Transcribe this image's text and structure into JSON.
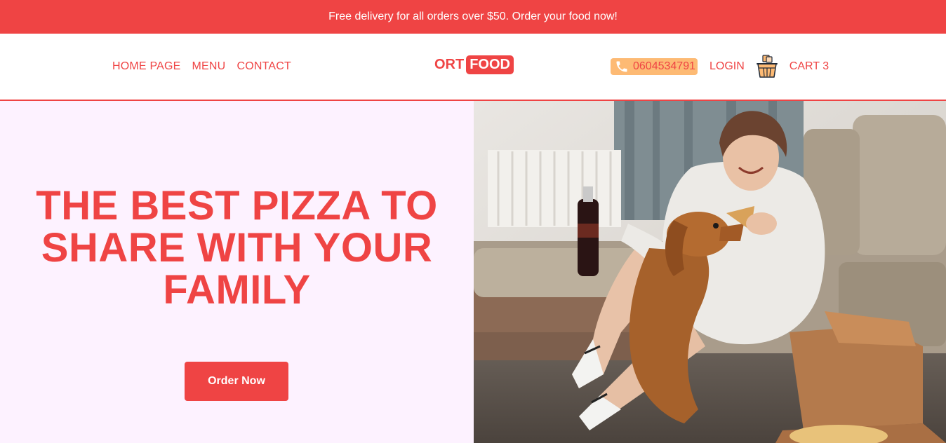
{
  "promo": {
    "text": "Free delivery for all orders over $50. Order your food now!"
  },
  "nav": {
    "links": [
      {
        "label": "HOME PAGE"
      },
      {
        "label": "MENU"
      },
      {
        "label": "CONTACT"
      }
    ],
    "logo": {
      "part1": "ORT",
      "part2": "FOOD"
    },
    "phone": "0604534791",
    "login": "LOGIN",
    "cart": "CART 3",
    "icons": {
      "phone": "phone-icon",
      "cart": "basket-icon"
    }
  },
  "hero": {
    "title": "THE BEST PIZZA TO SHARE WITH YOUR FAMILY",
    "button_label": "Order Now"
  },
  "colors": {
    "accent": "#ef4444",
    "hero_background": "#fdf2ff",
    "phone_pill": "#fdba74"
  }
}
